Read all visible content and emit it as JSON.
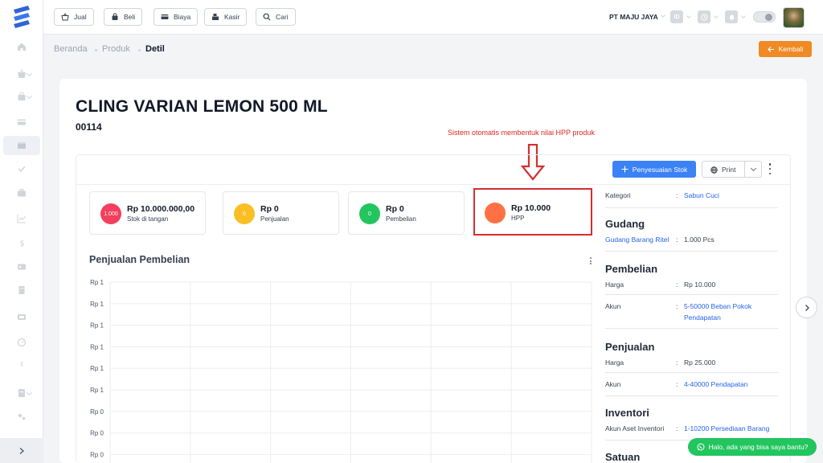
{
  "topbar": {
    "buttons": [
      {
        "label": "Jual",
        "icon": "basket-icon"
      },
      {
        "label": "Beli",
        "icon": "shopping-bag-icon"
      },
      {
        "label": "Biaya",
        "icon": "credit-card-icon"
      },
      {
        "label": "Kasir",
        "icon": "cash-register-icon"
      },
      {
        "label": "Cari",
        "icon": "search-icon"
      }
    ],
    "company": "PT MAJU JAYA",
    "language": "ID"
  },
  "breadcrumb": {
    "items": [
      "Beranda",
      "Produk"
    ],
    "current": "Detil"
  },
  "back_button": "Kembali",
  "product": {
    "name": "CLING VARIAN LEMON 500 ML",
    "code": "00114"
  },
  "annotation": "Sistem otomatis membentuk nilai HPP produk",
  "actions": {
    "adjust_stock": "Penyesuaian Stok",
    "print": "Print"
  },
  "stats": [
    {
      "badge": "1.000",
      "value": "Rp 10.000.000,00",
      "label": "Stok di tangan",
      "color": "#f43f5e"
    },
    {
      "badge": "0",
      "value": "Rp 0",
      "label": "Penjualan",
      "color": "#fbbf24"
    },
    {
      "badge": "0",
      "value": "Rp 0",
      "label": "Pembelian",
      "color": "#22c55e"
    },
    {
      "badge": "",
      "value": "Rp 10.000",
      "label": "HPP",
      "color": "#ff7043"
    }
  ],
  "chart_data": {
    "type": "line",
    "title": "Penjualan Pembelian",
    "y_tick_labels": [
      "Rp 1",
      "Rp 1",
      "Rp 1",
      "Rp 1",
      "Rp 1",
      "Rp 1",
      "Rp 0",
      "Rp 0",
      "Rp 0"
    ],
    "grid": true,
    "series": []
  },
  "details": {
    "kategori_label": "Kategori",
    "kategori_value": "Sabun Cuci",
    "gudang": {
      "title": "Gudang",
      "warehouse": "Gudang Barang Ritel",
      "qty": "1.000 Pcs"
    },
    "pembelian": {
      "title": "Pembelian",
      "harga_label": "Harga",
      "harga_value": "Rp 10.000",
      "akun_label": "Akun",
      "akun_value_line1": "5-50000 Beban Pokok",
      "akun_value_line2": "Pendapatan"
    },
    "penjualan": {
      "title": "Penjualan",
      "harga_label": "Harga",
      "harga_value": "Rp 25.000",
      "akun_label": "Akun",
      "akun_value": "4-40000 Pendapatan"
    },
    "inventori": {
      "title": "Inventori",
      "akun_label": "Akun Aset Inventori",
      "akun_value": "1-10200 Persediaan Barang"
    },
    "satuan_title": "Satuan"
  },
  "whatsapp": "Halo, ada yang bisa saya bantu?",
  "colors": {
    "primary": "#3b82f6",
    "accent": "#f08a24",
    "highlight": "#d32f2f",
    "whatsapp": "#22c55e"
  }
}
